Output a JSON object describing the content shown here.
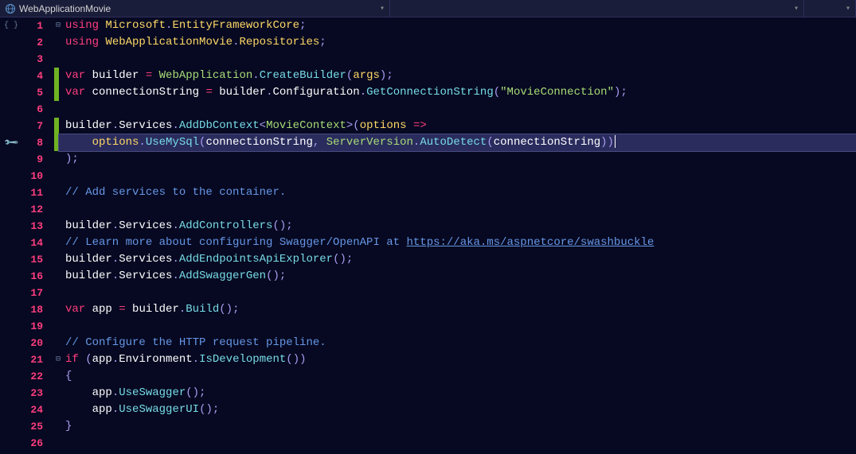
{
  "topBar": {
    "projectName": "WebApplicationMovie"
  },
  "icons": {
    "globe": "globe-icon",
    "collapse": "collapse-icon",
    "screwdriver": "screwdriver-icon",
    "dropdownArrow": "dropdown-arrow-icon",
    "foldMinus": "fold-minus-icon"
  },
  "editor": {
    "highlightedLine": 8,
    "lines": [
      {
        "num": 1,
        "change": false,
        "fold": "start",
        "tokens": [
          {
            "t": "kw",
            "v": "using"
          },
          {
            "t": "var",
            "v": " "
          },
          {
            "t": "ns",
            "v": "Microsoft"
          },
          {
            "t": "punct",
            "v": "."
          },
          {
            "t": "ns",
            "v": "EntityFrameworkCore"
          },
          {
            "t": "punct",
            "v": ";"
          }
        ]
      },
      {
        "num": 2,
        "change": false,
        "tokens": [
          {
            "t": "kw",
            "v": "using"
          },
          {
            "t": "var",
            "v": " "
          },
          {
            "t": "ns",
            "v": "WebApplicationMovie"
          },
          {
            "t": "punct",
            "v": "."
          },
          {
            "t": "ns",
            "v": "Repositories"
          },
          {
            "t": "punct",
            "v": ";"
          }
        ]
      },
      {
        "num": 3,
        "change": false,
        "tokens": []
      },
      {
        "num": 4,
        "change": true,
        "tokens": [
          {
            "t": "kw",
            "v": "var"
          },
          {
            "t": "var",
            "v": " builder "
          },
          {
            "t": "op",
            "v": "="
          },
          {
            "t": "var",
            "v": " "
          },
          {
            "t": "type",
            "v": "WebApplication"
          },
          {
            "t": "punct",
            "v": "."
          },
          {
            "t": "method",
            "v": "CreateBuilder"
          },
          {
            "t": "punct",
            "v": "("
          },
          {
            "t": "param",
            "v": "args"
          },
          {
            "t": "punct",
            "v": ");"
          }
        ]
      },
      {
        "num": 5,
        "change": true,
        "tokens": [
          {
            "t": "kw",
            "v": "var"
          },
          {
            "t": "var",
            "v": " connectionString "
          },
          {
            "t": "op",
            "v": "="
          },
          {
            "t": "var",
            "v": " builder"
          },
          {
            "t": "punct",
            "v": "."
          },
          {
            "t": "prop",
            "v": "Configuration"
          },
          {
            "t": "punct",
            "v": "."
          },
          {
            "t": "method",
            "v": "GetConnectionString"
          },
          {
            "t": "punct",
            "v": "("
          },
          {
            "t": "str",
            "v": "\"MovieConnection\""
          },
          {
            "t": "punct",
            "v": ");"
          }
        ]
      },
      {
        "num": 6,
        "change": false,
        "tokens": []
      },
      {
        "num": 7,
        "change": true,
        "tokens": [
          {
            "t": "var",
            "v": "builder"
          },
          {
            "t": "punct",
            "v": "."
          },
          {
            "t": "prop",
            "v": "Services"
          },
          {
            "t": "punct",
            "v": "."
          },
          {
            "t": "method",
            "v": "AddDbContext"
          },
          {
            "t": "punct",
            "v": "<"
          },
          {
            "t": "type",
            "v": "MovieContext"
          },
          {
            "t": "punct",
            "v": ">("
          },
          {
            "t": "param",
            "v": "options"
          },
          {
            "t": "var",
            "v": " "
          },
          {
            "t": "op",
            "v": "=>"
          }
        ]
      },
      {
        "num": 8,
        "change": true,
        "highlighted": true,
        "marginIcon": "screwdriver",
        "indent": 1,
        "tokens": [
          {
            "t": "param",
            "v": "options"
          },
          {
            "t": "punct",
            "v": "."
          },
          {
            "t": "method",
            "v": "UseMySql"
          },
          {
            "t": "punct",
            "v": "("
          },
          {
            "t": "var",
            "v": "connectionString"
          },
          {
            "t": "punct",
            "v": ", "
          },
          {
            "t": "type",
            "v": "ServerVersion"
          },
          {
            "t": "punct",
            "v": "."
          },
          {
            "t": "method",
            "v": "AutoDetect"
          },
          {
            "t": "punct",
            "v": "("
          },
          {
            "t": "var",
            "v": "connectionString"
          },
          {
            "t": "punct",
            "v": "))"
          }
        ],
        "cursor": true
      },
      {
        "num": 9,
        "change": false,
        "tokens": [
          {
            "t": "punct",
            "v": ");"
          }
        ]
      },
      {
        "num": 10,
        "change": false,
        "tokens": []
      },
      {
        "num": 11,
        "change": false,
        "tokens": [
          {
            "t": "comment",
            "v": "// Add services to the container."
          }
        ]
      },
      {
        "num": 12,
        "change": false,
        "tokens": []
      },
      {
        "num": 13,
        "change": false,
        "tokens": [
          {
            "t": "var",
            "v": "builder"
          },
          {
            "t": "punct",
            "v": "."
          },
          {
            "t": "prop",
            "v": "Services"
          },
          {
            "t": "punct",
            "v": "."
          },
          {
            "t": "method",
            "v": "AddControllers"
          },
          {
            "t": "punct",
            "v": "();"
          }
        ]
      },
      {
        "num": 14,
        "change": false,
        "tokens": [
          {
            "t": "comment",
            "v": "// Learn more about configuring Swagger/OpenAPI at "
          },
          {
            "t": "link",
            "v": "https://aka.ms/aspnetcore/swashbuckle"
          }
        ]
      },
      {
        "num": 15,
        "change": false,
        "tokens": [
          {
            "t": "var",
            "v": "builder"
          },
          {
            "t": "punct",
            "v": "."
          },
          {
            "t": "prop",
            "v": "Services"
          },
          {
            "t": "punct",
            "v": "."
          },
          {
            "t": "method",
            "v": "AddEndpointsApiExplorer"
          },
          {
            "t": "punct",
            "v": "();"
          }
        ]
      },
      {
        "num": 16,
        "change": false,
        "tokens": [
          {
            "t": "var",
            "v": "builder"
          },
          {
            "t": "punct",
            "v": "."
          },
          {
            "t": "prop",
            "v": "Services"
          },
          {
            "t": "punct",
            "v": "."
          },
          {
            "t": "method",
            "v": "AddSwaggerGen"
          },
          {
            "t": "punct",
            "v": "();"
          }
        ]
      },
      {
        "num": 17,
        "change": false,
        "tokens": []
      },
      {
        "num": 18,
        "change": false,
        "tokens": [
          {
            "t": "kw",
            "v": "var"
          },
          {
            "t": "var",
            "v": " app "
          },
          {
            "t": "op",
            "v": "="
          },
          {
            "t": "var",
            "v": " builder"
          },
          {
            "t": "punct",
            "v": "."
          },
          {
            "t": "method",
            "v": "Build"
          },
          {
            "t": "punct",
            "v": "();"
          }
        ]
      },
      {
        "num": 19,
        "change": false,
        "tokens": []
      },
      {
        "num": 20,
        "change": false,
        "tokens": [
          {
            "t": "comment",
            "v": "// Configure the HTTP request pipeline."
          }
        ]
      },
      {
        "num": 21,
        "change": false,
        "fold": "start",
        "tokens": [
          {
            "t": "kw",
            "v": "if"
          },
          {
            "t": "var",
            "v": " "
          },
          {
            "t": "punct",
            "v": "("
          },
          {
            "t": "var",
            "v": "app"
          },
          {
            "t": "punct",
            "v": "."
          },
          {
            "t": "prop",
            "v": "Environment"
          },
          {
            "t": "punct",
            "v": "."
          },
          {
            "t": "method",
            "v": "IsDevelopment"
          },
          {
            "t": "punct",
            "v": "())"
          }
        ]
      },
      {
        "num": 22,
        "change": false,
        "tokens": [
          {
            "t": "punct",
            "v": "{"
          }
        ]
      },
      {
        "num": 23,
        "change": false,
        "indent": 1,
        "tokens": [
          {
            "t": "var",
            "v": "app"
          },
          {
            "t": "punct",
            "v": "."
          },
          {
            "t": "method",
            "v": "UseSwagger"
          },
          {
            "t": "punct",
            "v": "();"
          }
        ]
      },
      {
        "num": 24,
        "change": false,
        "indent": 1,
        "tokens": [
          {
            "t": "var",
            "v": "app"
          },
          {
            "t": "punct",
            "v": "."
          },
          {
            "t": "method",
            "v": "UseSwaggerUI"
          },
          {
            "t": "punct",
            "v": "();"
          }
        ]
      },
      {
        "num": 25,
        "change": false,
        "tokens": [
          {
            "t": "punct",
            "v": "}"
          }
        ]
      },
      {
        "num": 26,
        "change": false,
        "tokens": []
      }
    ]
  }
}
